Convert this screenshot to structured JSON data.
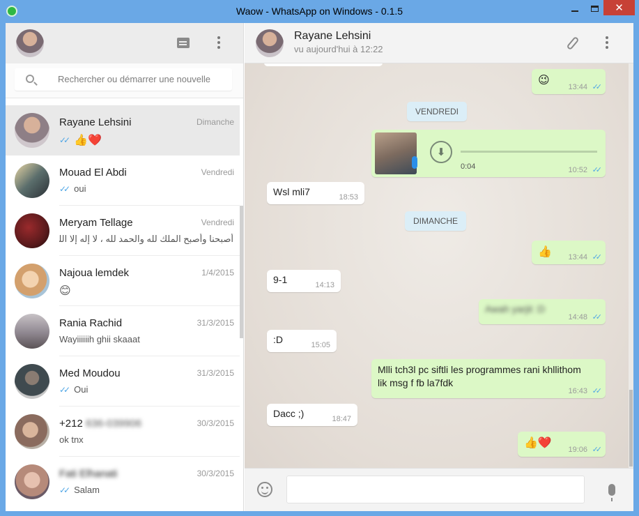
{
  "window": {
    "title": "Waow - WhatsApp on Windows - 0.1.5",
    "close_glyph": "✕"
  },
  "sidebar": {
    "search_placeholder": "Rechercher ou démarrer une nouvelle",
    "chats": [
      {
        "name": "Rayane Lehsini",
        "date": "Dimanche",
        "preview": "👍❤️",
        "ticks": true,
        "color": "#8e7f86"
      },
      {
        "name": "Mouad El Abdi",
        "date": "Vendredi",
        "preview": "oui",
        "ticks": true,
        "color": "#5b6e6c"
      },
      {
        "name": "Meryam Tellage",
        "date": "Vendredi",
        "preview": "أصبحنا وأصبح الملك لله والحمد لله ، لا إله إلا الله و",
        "ticks": false,
        "color": "#5a1a1c"
      },
      {
        "name": "Najoua lemdek",
        "date": "1/4/2015",
        "preview": "😊",
        "ticks": false,
        "color": "#d3a06d"
      },
      {
        "name": "Rania Rachid",
        "date": "31/3/2015",
        "preview": "Wayiiiiiih ghii skaaat",
        "ticks": false,
        "color": "#8f8790"
      },
      {
        "name": "Med Moudou",
        "date": "31/3/2015",
        "preview": "Oui",
        "ticks": true,
        "color": "#3f4a4f"
      },
      {
        "name": "+212",
        "name_blurred": "636-039906",
        "date": "30/3/2015",
        "preview": "ok tnx",
        "ticks": false,
        "color": "#8a6b5e"
      },
      {
        "name": "Fati Elhanati",
        "date": "30/3/2015",
        "preview": "Salam",
        "ticks": true,
        "color": "#b68a7a"
      }
    ]
  },
  "conversation": {
    "contact_name": "Rayane Lehsini",
    "contact_status": "vu aujourd'hui à 12:22",
    "ticks_glyph": "✓✓",
    "download_glyph": "⬇",
    "messages": [
      {
        "text": "😉",
        "time": "13:44"
      },
      {
        "day": "VENDREDI"
      },
      {
        "audio_duration": "0:04",
        "time": "10:52"
      },
      {
        "text": "Wsl mli7",
        "time": "18:53"
      },
      {
        "day": "DIMANCHE"
      },
      {
        "text": "👍",
        "time": "13:44"
      },
      {
        "text": "9-1",
        "time": "14:13"
      },
      {
        "text": "Awah yarjit :D",
        "time": "14:48"
      },
      {
        "text": ":D",
        "time": "15:05"
      },
      {
        "text": "Mlli tch3l pc siftli les programmes rani khllithom lik msg f fb la7fdk",
        "time": "16:43"
      },
      {
        "text": "Dacc ;)",
        "time": "18:47"
      },
      {
        "text": "👍❤️",
        "time": "19:06"
      }
    ]
  },
  "composer": {
    "value": "",
    "placeholder": ""
  }
}
